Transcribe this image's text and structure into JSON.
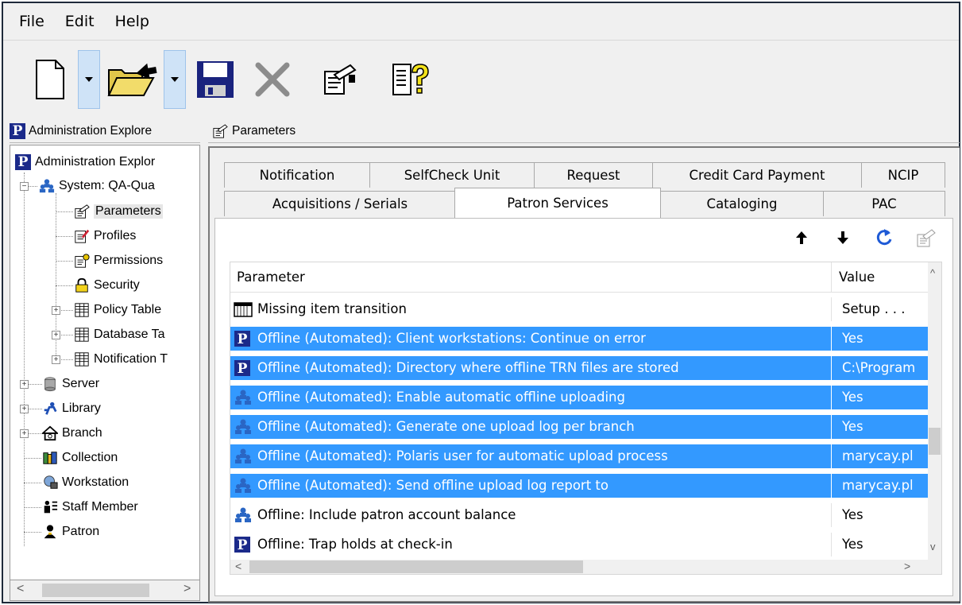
{
  "menu": {
    "items": [
      "File",
      "Edit",
      "Help"
    ]
  },
  "toolbar": {
    "buttons": [
      "new-document-icon",
      "open-folder-icon",
      "save-disk-icon",
      "delete-x-icon",
      "properties-icon",
      "help-icon"
    ]
  },
  "left_pane": {
    "title": "Administration Explore",
    "tree": [
      {
        "label": "Administration Explor",
        "icon": "polaris-logo-icon"
      },
      {
        "label": "System: QA-Qua",
        "icon": "system-users-icon"
      },
      {
        "label": "Parameters",
        "icon": "parameters-icon",
        "selected": true
      },
      {
        "label": "Profiles",
        "icon": "profiles-icon"
      },
      {
        "label": "Permissions",
        "icon": "permissions-icon"
      },
      {
        "label": "Security",
        "icon": "lock-icon"
      },
      {
        "label": "Policy Table",
        "icon": "table-icon"
      },
      {
        "label": "Database Ta",
        "icon": "table-icon"
      },
      {
        "label": "Notification T",
        "icon": "table-icon"
      },
      {
        "label": "Server",
        "icon": "server-icon"
      },
      {
        "label": "Library",
        "icon": "library-icon"
      },
      {
        "label": "Branch",
        "icon": "branch-icon"
      },
      {
        "label": "Collection",
        "icon": "collection-icon"
      },
      {
        "label": "Workstation",
        "icon": "workstation-icon"
      },
      {
        "label": "Staff Member",
        "icon": "staff-member-icon"
      },
      {
        "label": "Patron",
        "icon": "patron-icon"
      }
    ]
  },
  "right_pane": {
    "title": "Parameters",
    "tabs_row1": [
      "Notification",
      "SelfCheck Unit",
      "Request",
      "Credit Card Payment",
      "NCIP"
    ],
    "tabs_row2": [
      "Acquisitions / Serials",
      "Patron Services",
      "Cataloging",
      "PAC"
    ],
    "active_tab": "Patron Services",
    "grid": {
      "col_parameter": "Parameter",
      "col_value": "Value",
      "rows": [
        {
          "name": "Missing item transition",
          "value": "Setup . . .",
          "icon": "calendar-icon",
          "selected": false
        },
        {
          "name": "Offline (Automated): Client workstations: Continue on error",
          "value": "Yes",
          "icon": "polaris-logo-icon",
          "selected": true
        },
        {
          "name": "Offline (Automated): Directory where offline TRN files are stored",
          "value": "C:\\Program",
          "icon": "polaris-logo-icon",
          "selected": true
        },
        {
          "name": "Offline (Automated): Enable automatic offline uploading",
          "value": "Yes",
          "icon": "system-users-icon",
          "selected": true
        },
        {
          "name": "Offline (Automated): Generate one upload log per branch",
          "value": "Yes",
          "icon": "system-users-icon",
          "selected": true
        },
        {
          "name": "Offline (Automated): Polaris user for automatic upload process",
          "value": "marycay.pl",
          "icon": "system-users-icon",
          "selected": true
        },
        {
          "name": "Offline (Automated): Send offline upload log report to",
          "value": "marycay.pl",
          "icon": "system-users-icon",
          "selected": true
        },
        {
          "name": "Offline: Include patron account balance",
          "value": "Yes",
          "icon": "system-users-icon",
          "selected": false
        },
        {
          "name": "Offline: Trap holds at check-in",
          "value": "Yes",
          "icon": "polaris-logo-icon",
          "selected": false
        }
      ]
    }
  },
  "colors": {
    "selection": "#3399ff",
    "polaris_logo": "#1b2a8a"
  }
}
